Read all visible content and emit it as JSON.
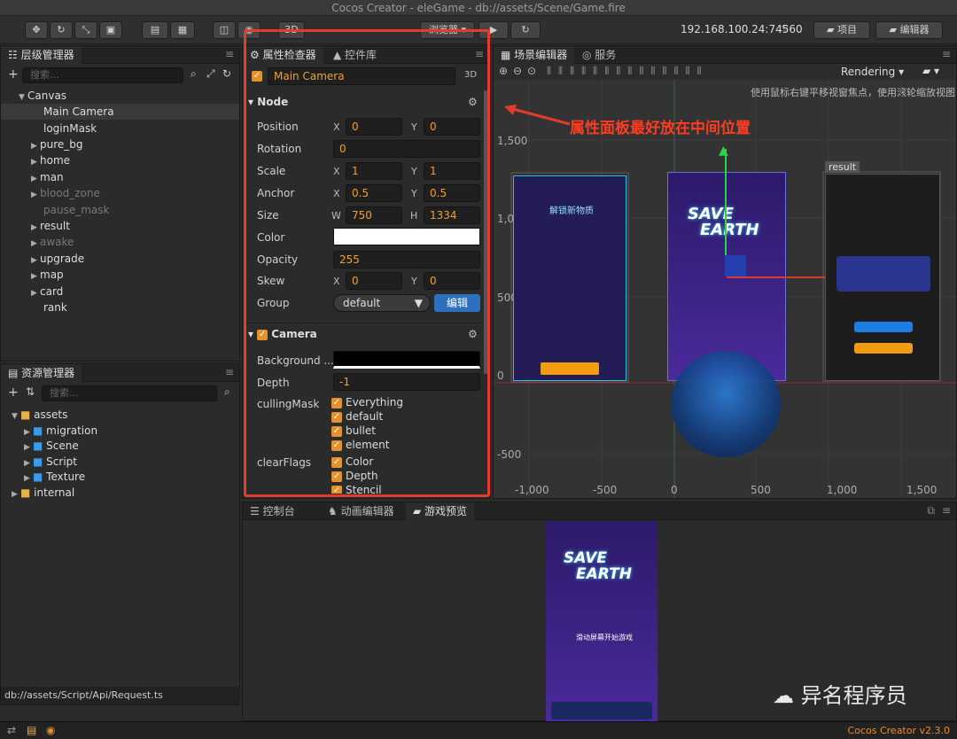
{
  "window_title": "Cocos Creator - eleGame - db://assets/Scene/Game.fire",
  "toolbar": {
    "browser_label": "浏览器",
    "ip": "192.168.100.24:7456",
    "wifi_count": "0",
    "project_label": "项目",
    "editor_label": "编辑器",
    "btn_3d": "3D"
  },
  "hierarchy": {
    "title": "层级管理器",
    "search_placeholder": "搜索...",
    "items": [
      {
        "label": "Canvas"
      },
      {
        "label": "Main Camera"
      },
      {
        "label": "loginMask"
      },
      {
        "label": "pure_bg"
      },
      {
        "label": "home"
      },
      {
        "label": "man"
      },
      {
        "label": "blood_zone"
      },
      {
        "label": "pause_mask"
      },
      {
        "label": "result"
      },
      {
        "label": "awake"
      },
      {
        "label": "upgrade"
      },
      {
        "label": "map"
      },
      {
        "label": "card"
      },
      {
        "label": "rank"
      }
    ]
  },
  "assets": {
    "title": "资源管理器",
    "search_placeholder": "搜索...",
    "items": [
      {
        "label": "assets"
      },
      {
        "label": "migration"
      },
      {
        "label": "Scene"
      },
      {
        "label": "Script"
      },
      {
        "label": "Texture"
      },
      {
        "label": "internal"
      }
    ],
    "status_path": "db://assets/Script/Api/Request.ts"
  },
  "inspector": {
    "tab_inspector": "属性检查器",
    "tab_library": "控件库",
    "node_name": "Main Camera",
    "node_badge": "3D",
    "node_section": "Node",
    "props": {
      "position": {
        "label": "Position",
        "x": "0",
        "y": "0"
      },
      "rotation": {
        "label": "Rotation",
        "v": "0"
      },
      "scale": {
        "label": "Scale",
        "x": "1",
        "y": "1"
      },
      "anchor": {
        "label": "Anchor",
        "x": "0.5",
        "y": "0.5"
      },
      "size": {
        "label": "Size",
        "w": "750",
        "h": "1334"
      },
      "color": {
        "label": "Color"
      },
      "opacity": {
        "label": "Opacity",
        "v": "255"
      },
      "skew": {
        "label": "Skew",
        "x": "0",
        "y": "0"
      },
      "group": {
        "label": "Group",
        "v": "default",
        "edit": "编辑"
      }
    },
    "camera_section": "Camera",
    "camera": {
      "background": {
        "label": "Background ..."
      },
      "depth": {
        "label": "Depth",
        "v": "-1"
      },
      "culling": {
        "label": "cullingMask",
        "options": [
          "Everything",
          "default",
          "bullet",
          "element"
        ]
      },
      "clear": {
        "label": "clearFlags",
        "options": [
          "Color",
          "Depth",
          "Stencil"
        ]
      }
    },
    "axis_x": "X",
    "axis_y": "Y",
    "axis_w": "W",
    "axis_h": "H"
  },
  "scene": {
    "tab_scene": "场景编辑器",
    "tab_service": "服务",
    "rendering": "Rendering",
    "hint": "使用鼠标右键平移视窗焦点，使用滚轮缩放视图",
    "annotation": "属性面板最好放在中间位置",
    "y_labels": [
      "1,500",
      "1,000",
      "500",
      "0",
      "-500"
    ],
    "x_labels": [
      "-1,000",
      "-500",
      "0",
      "500",
      "1,000",
      "1,500"
    ],
    "result_label": "result",
    "game_title_1": "SAVE",
    "game_title_2": "EARTH",
    "card_title": "解锁新物质"
  },
  "bottom": {
    "tab_console": "控制台",
    "tab_anim": "动画编辑器",
    "tab_preview": "游戏预览",
    "preview_title_1": "SAVE",
    "preview_title_2": "EARTH",
    "preview_sub": "滑动屏幕开始游戏"
  },
  "watermark": "异名程序员",
  "version": "Cocos Creator v2.3.0",
  "colors": {
    "accent": "#e6912b",
    "highlight": "#e53b2c",
    "blue": "#2f6fbf"
  }
}
